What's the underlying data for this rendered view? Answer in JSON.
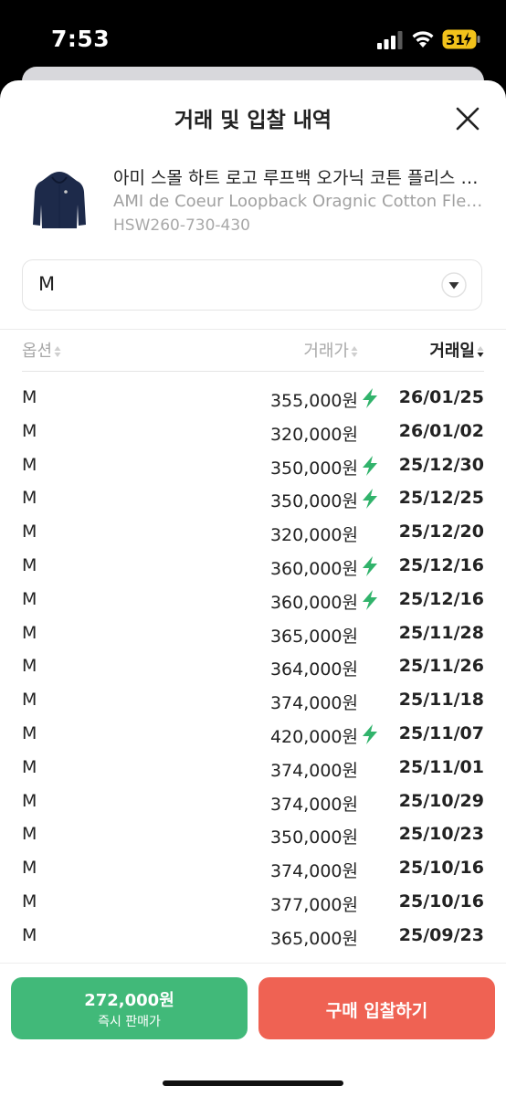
{
  "status_bar": {
    "time": "7:53",
    "battery": "31"
  },
  "sheet": {
    "title": "거래 및 입찰 내역"
  },
  "product": {
    "name_ko": "아미 스몰 하트 로고 루프백 오가닉 코튼 플리스 후디 네이비",
    "name_en": "AMI de Coeur Loopback Oragnic Cotton Fleece Hoodie Navy",
    "code": "HSW260-730-430"
  },
  "option_select": {
    "value": "M"
  },
  "table": {
    "headers": {
      "option": "옵션",
      "price": "거래가",
      "date": "거래일"
    },
    "rows": [
      {
        "option": "M",
        "price": "355,000원",
        "quick": true,
        "date": "26/01/25"
      },
      {
        "option": "M",
        "price": "320,000원",
        "quick": false,
        "date": "26/01/02"
      },
      {
        "option": "M",
        "price": "350,000원",
        "quick": true,
        "date": "25/12/30"
      },
      {
        "option": "M",
        "price": "350,000원",
        "quick": true,
        "date": "25/12/25"
      },
      {
        "option": "M",
        "price": "320,000원",
        "quick": false,
        "date": "25/12/20"
      },
      {
        "option": "M",
        "price": "360,000원",
        "quick": true,
        "date": "25/12/16"
      },
      {
        "option": "M",
        "price": "360,000원",
        "quick": true,
        "date": "25/12/16"
      },
      {
        "option": "M",
        "price": "365,000원",
        "quick": false,
        "date": "25/11/28"
      },
      {
        "option": "M",
        "price": "364,000원",
        "quick": false,
        "date": "25/11/26"
      },
      {
        "option": "M",
        "price": "374,000원",
        "quick": false,
        "date": "25/11/18"
      },
      {
        "option": "M",
        "price": "420,000원",
        "quick": true,
        "date": "25/11/07"
      },
      {
        "option": "M",
        "price": "374,000원",
        "quick": false,
        "date": "25/11/01"
      },
      {
        "option": "M",
        "price": "374,000원",
        "quick": false,
        "date": "25/10/29"
      },
      {
        "option": "M",
        "price": "350,000원",
        "quick": false,
        "date": "25/10/23"
      },
      {
        "option": "M",
        "price": "374,000원",
        "quick": false,
        "date": "25/10/16"
      },
      {
        "option": "M",
        "price": "377,000원",
        "quick": false,
        "date": "25/10/16"
      },
      {
        "option": "M",
        "price": "365,000원",
        "quick": false,
        "date": "25/09/23"
      }
    ]
  },
  "bottom": {
    "sell_price": "272,000원",
    "sell_label": "즉시 판매가",
    "buy_label": "구매 입찰하기"
  },
  "colors": {
    "sell": "#41b979",
    "buy": "#ef6253",
    "bolt": "#31b36b"
  }
}
